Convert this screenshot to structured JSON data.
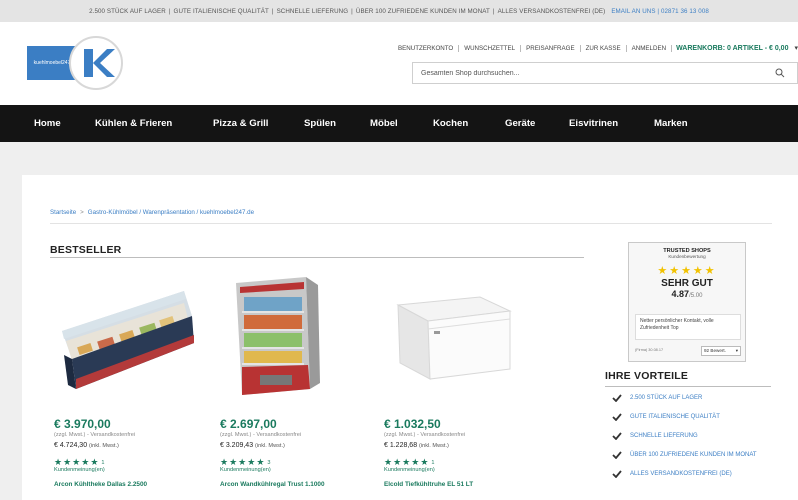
{
  "topbar": {
    "items": [
      "2.500 STÜCK AUF LAGER",
      "GUTE ITALIENISCHE QUALITÄT",
      "SCHNELLE LIEFERUNG",
      "ÜBER 100 ZUFRIEDENE KUNDEN IM MONAT",
      "ALLES VERSANDKOSTENFREI (DE)"
    ],
    "contact": "EMAIL AN UNS | 02871 36 13 008"
  },
  "header": {
    "logo_text": "kuehlmoebel247.de",
    "links": [
      "BENUTZERKONTO",
      "WUNSCHZETTEL",
      "PREISANFRAGE",
      "ZUR KASSE",
      "ANMELDEN"
    ],
    "cart": "WARENKORB: 0 ARTIKEL - € 0,00",
    "search_placeholder": "Gesamten Shop durchsuchen..."
  },
  "nav": {
    "items": [
      "Home",
      "Kühlen & Frieren",
      "Pizza & Grill",
      "Spülen",
      "Möbel",
      "Kochen",
      "Geräte",
      "Eisvitrinen",
      "Marken"
    ]
  },
  "breadcrumb": {
    "items": [
      "Startseite",
      "Gastro-Kühlmöbel / Warenpräsentation / kuehlmoebel247.de"
    ]
  },
  "bestseller": {
    "title": "BESTSELLER",
    "products": [
      {
        "price": "€ 3.970,00",
        "sub": "(zzgl. Mwst.) - Versandkostenfrei",
        "inkl_price": "€ 4.724,30",
        "inkl_label": "(inkl. Mwst.)",
        "reviews": "1",
        "reviews_label": "Kundenmeinung(en)",
        "name": "Arcon Kühltheke Dallas 2.2500"
      },
      {
        "price": "€ 2.697,00",
        "sub": "(zzgl. Mwst.) - Versandkostenfrei",
        "inkl_price": "€ 3.209,43",
        "inkl_label": "(inkl. Mwst.)",
        "reviews": "3",
        "reviews_label": "Kundenmeinung(en)",
        "name": "Arcon Wandkühlregal Trust 1.1000"
      },
      {
        "price": "€ 1.032,50",
        "sub": "(zzgl. Mwst.) - Versandkostenfrei",
        "inkl_price": "€ 1.228,68",
        "inkl_label": "(inkl. Mwst.)",
        "reviews": "1",
        "reviews_label": "Kundenmeinung(en)",
        "name": "Elcold Tiefkühltruhe EL 51 LT"
      }
    ]
  },
  "trusted_shops": {
    "title": "TRUSTED SHOPS",
    "subtitle": "Kundenbewertung",
    "stars": "★★★★★",
    "rating": "SEHR GUT",
    "score": "4.87",
    "score_of": "/5.00",
    "comment": "Netter persönlicher Kontakt, volle Zufriedenheit Top",
    "date": "(Firma) 30.08.17",
    "select_label": "92 Bewert."
  },
  "vorteile": {
    "title": "IHRE VORTEILE",
    "items": [
      "2.500 STÜCK AUF LAGER",
      "GUTE ITALIENISCHE QUALITÄT",
      "SCHNELLE LIEFERUNG",
      "ÜBER 100 ZUFRIEDENE KUNDEN IM MONAT",
      "ALLES VERSANDKOSTENFREI (DE)"
    ]
  },
  "colors": {
    "accent_green": "#1a7a5e",
    "link_blue": "#3b7ec4",
    "nav_bg": "#141414",
    "star_yellow": "#f2c200"
  }
}
